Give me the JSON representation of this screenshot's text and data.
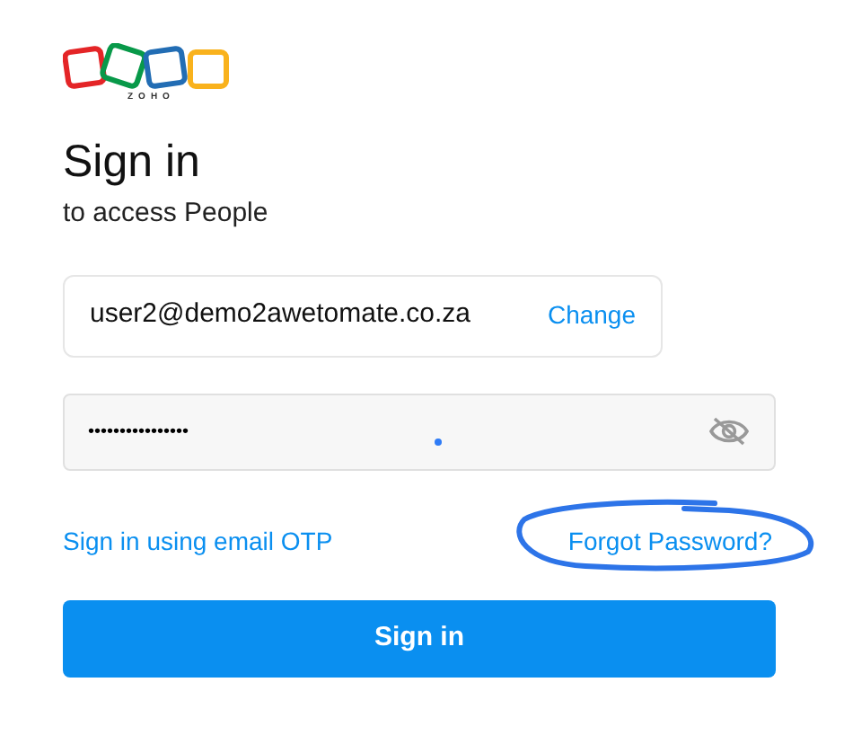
{
  "logo": {
    "wordmark": "ZOHO"
  },
  "heading": "Sign in",
  "subheading": "to access People",
  "email": {
    "value": "user2@demo2awetomate.co.za",
    "action": "Change"
  },
  "password": {
    "value": "••••••••••••••••",
    "show": false
  },
  "links": [
    {
      "label": "Sign in using email OTP",
      "circled": false
    },
    {
      "label": "Forgot Password?",
      "circled": true
    }
  ],
  "submit": "Sign in"
}
